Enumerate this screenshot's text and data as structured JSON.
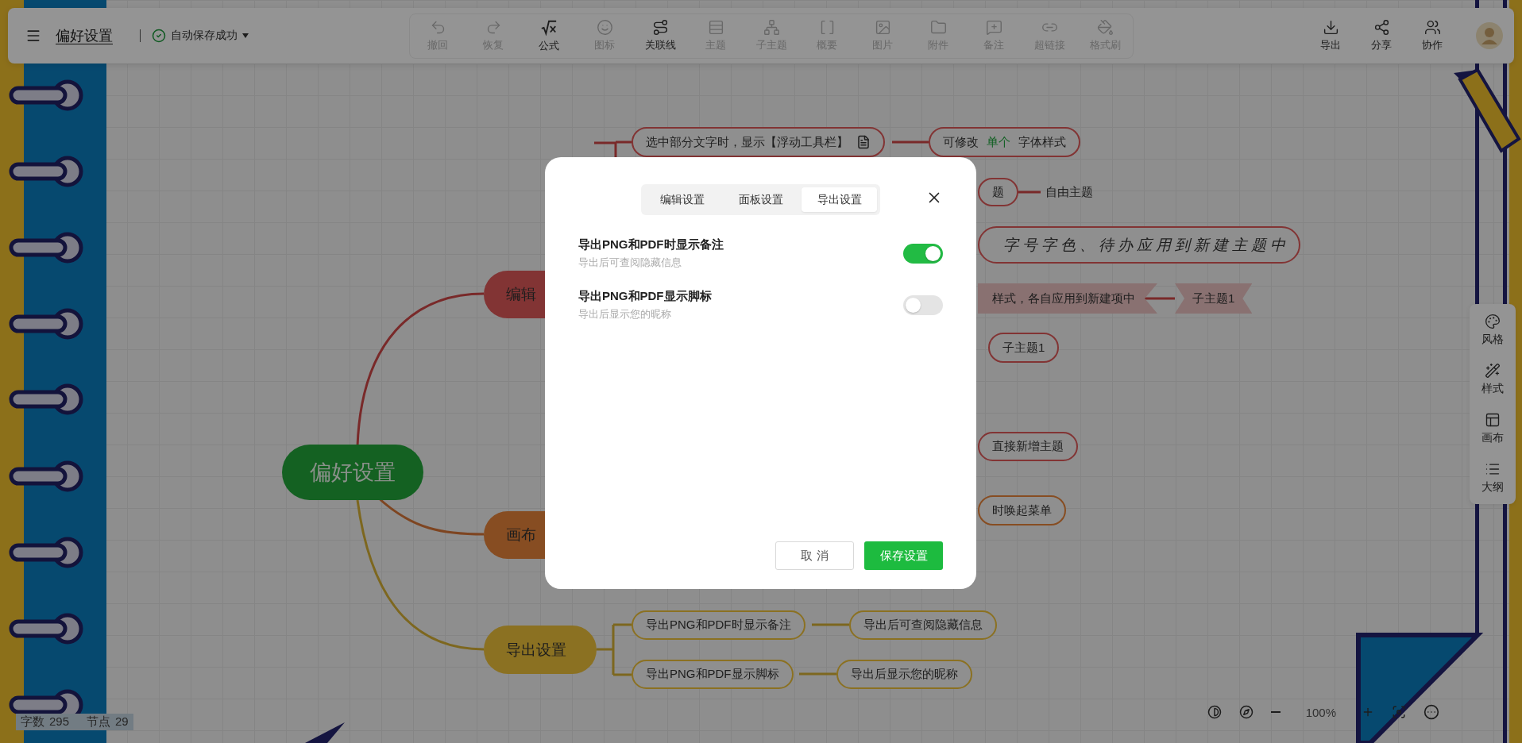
{
  "toolbar": {
    "title": "偏好设置",
    "save_status": "自动保存成功",
    "tools": [
      {
        "label": "撤回",
        "disabled": true
      },
      {
        "label": "恢复",
        "disabled": true
      },
      {
        "label": "公式",
        "disabled": false
      },
      {
        "label": "图标",
        "disabled": true
      },
      {
        "label": "关联线",
        "disabled": false
      },
      {
        "label": "主题",
        "disabled": true
      },
      {
        "label": "子主题",
        "disabled": true
      },
      {
        "label": "概要",
        "disabled": true
      },
      {
        "label": "图片",
        "disabled": true
      },
      {
        "label": "附件",
        "disabled": true
      },
      {
        "label": "备注",
        "disabled": true
      },
      {
        "label": "超链接",
        "disabled": true
      },
      {
        "label": "格式刷",
        "disabled": true
      }
    ],
    "actions": [
      {
        "label": "导出"
      },
      {
        "label": "分享"
      },
      {
        "label": "协作"
      }
    ]
  },
  "mindmap": {
    "nodes": [
      {
        "kind": "root",
        "text": "偏好设置",
        "color": "#146122"
      },
      {
        "kind": "branch",
        "text": "编辑",
        "color": "#823434"
      },
      {
        "kind": "branch",
        "text": "画布",
        "color": "#874d22"
      },
      {
        "kind": "branch",
        "text": "导出设置",
        "color": "#8b7122"
      },
      {
        "kind": "topic",
        "text": "选中部分文字时，显示【浮动工具栏】",
        "color": "#823434",
        "note": true
      },
      {
        "kind": "topic",
        "parts": [
          {
            "text": "可修改",
            "highlight": false
          },
          {
            "text": "单个",
            "highlight": true
          },
          {
            "text": "字体样式",
            "highlight": false
          }
        ],
        "color": "#823434"
      },
      {
        "kind": "topic",
        "text": "题",
        "color": "#823434"
      },
      {
        "kind": "plain",
        "text": "自由主题"
      },
      {
        "kind": "handwriting",
        "text": "字号字色、待办应用到新建主题中",
        "color": "#823434"
      },
      {
        "kind": "banner",
        "text": "样式，各自应用到新建项中",
        "color": "#897171"
      },
      {
        "kind": "ribbon",
        "text": "子主题1",
        "color": "#897171"
      },
      {
        "kind": "topic",
        "text": "子主题1",
        "color": "#823434"
      },
      {
        "kind": "topic",
        "text": "直接新增主题",
        "color": "#823434"
      },
      {
        "kind": "topic",
        "text": "时唤起菜单",
        "color": "#874d22"
      },
      {
        "kind": "topic",
        "text": "导出PNG和PDF时显示备注",
        "color": "#8b7122"
      },
      {
        "kind": "topic",
        "text": "导出后可查阅隐藏信息",
        "color": "#8b7122"
      },
      {
        "kind": "topic",
        "text": "导出PNG和PDF显示脚标",
        "color": "#8b7122"
      },
      {
        "kind": "topic",
        "text": "导出后显示您的昵称",
        "color": "#8b7122"
      }
    ]
  },
  "side_panel": [
    {
      "label": "风格"
    },
    {
      "label": "样式"
    },
    {
      "label": "画布"
    },
    {
      "label": "大纲"
    }
  ],
  "status_bar": {
    "words_label": "字数",
    "words": "295",
    "nodes_label": "节点",
    "nodes": "29"
  },
  "zoom": {
    "level_text": "100%"
  },
  "dialog": {
    "tabs": [
      {
        "label": "编辑设置",
        "selected": false
      },
      {
        "label": "面板设置",
        "selected": false
      },
      {
        "label": "导出设置",
        "selected": true
      }
    ],
    "settings": [
      {
        "title": "导出PNG和PDF时显示备注",
        "description": "导出后可查阅隐藏信息",
        "on": true
      },
      {
        "title": "导出PNG和PDF显示脚标",
        "description": "导出后显示您的昵称",
        "on": false
      }
    ],
    "buttons": [
      {
        "label": "取 消",
        "kind": "secondary"
      },
      {
        "label": "保存设置",
        "kind": "primary"
      }
    ]
  }
}
